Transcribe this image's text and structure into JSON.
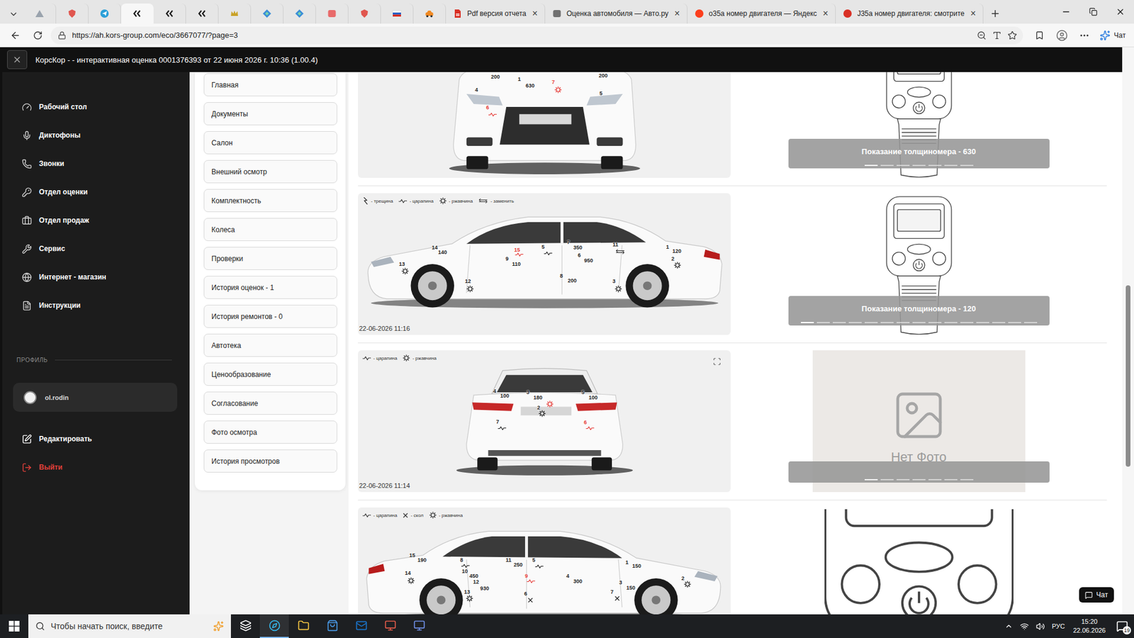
{
  "browser": {
    "pinned_tabs": [
      {
        "color": "#9aa3ad",
        "selected": false
      },
      {
        "color": "#e0564f",
        "selected": false
      },
      {
        "color": "#2a9fd8",
        "selected": false
      },
      {
        "color": "#1b1b1b",
        "selected": true
      },
      {
        "color": "#1b1b1b",
        "selected": false
      },
      {
        "color": "#1b1b1b",
        "selected": false
      },
      {
        "color": "#c9a227",
        "selected": false
      },
      {
        "color": "#3b8ed8",
        "selected": false
      },
      {
        "color": "#3b8ed8",
        "selected": false
      },
      {
        "color": "#e86a6a",
        "selected": false
      },
      {
        "color": "#e0564f",
        "selected": false
      },
      {
        "color": "#d52b1e",
        "selected": false
      },
      {
        "color": "#f08a24",
        "selected": false
      }
    ],
    "tabs": [
      {
        "title": "Pdf версия отчета",
        "color": "#d93025",
        "selected": false
      },
      {
        "title": "Оценка автомобиля — Авто.ру",
        "color": "#707070",
        "selected": false
      },
      {
        "title": "о35а номер двигателя — Яндекс",
        "color": "#fc3f1d",
        "selected": false
      },
      {
        "title": "J35a номер двигателя: смотрите",
        "color": "#d93025",
        "selected": false
      }
    ],
    "close_glyph": "×",
    "url": "https://ah.kors-group.com/eco/3667077/?page=3",
    "copilot": "Чат"
  },
  "app": {
    "title": "КорсКор - - интерактивная оценка 0001376393 от 22 июня 2026 г. 10:36 (1.00.4)"
  },
  "sidebar": {
    "items": [
      {
        "label": "Рабочий стол"
      },
      {
        "label": "Диктофоны"
      },
      {
        "label": "Звонки"
      },
      {
        "label": "Отдел оценки"
      },
      {
        "label": "Отдел продаж"
      },
      {
        "label": "Сервис"
      },
      {
        "label": "Интернет - магазин"
      },
      {
        "label": "Инструкции"
      }
    ],
    "profile_heading": "ПРОФИЛЬ",
    "user": "ol.rodin",
    "actions": [
      {
        "label": "Редактировать",
        "color": "#ffffff"
      },
      {
        "label": "Выйти",
        "color": "#e0403a"
      }
    ]
  },
  "menu": {
    "items": [
      {
        "label": "Главная"
      },
      {
        "label": "Документы"
      },
      {
        "label": "Салон"
      },
      {
        "label": "Внешний осмотр"
      },
      {
        "label": "Комплектность"
      },
      {
        "label": "Колеса"
      },
      {
        "label": "Проверки"
      },
      {
        "label": "История оценок - 1"
      },
      {
        "label": "История ремонтов - 0"
      },
      {
        "label": "Автотека"
      },
      {
        "label": "Ценообразование"
      },
      {
        "label": "Согласование"
      },
      {
        "label": "Фото осмотра"
      },
      {
        "label": "История просмотров"
      }
    ]
  },
  "inspection": {
    "rows": [
      {
        "view": "front",
        "legend": [],
        "expandable": false,
        "marks": [
          {
            "kind": "label",
            "text": "200",
            "color": "#222222"
          },
          {
            "kind": "label",
            "text": "1",
            "color": "#222222"
          },
          {
            "kind": "label",
            "text": "630",
            "color": "#222222"
          },
          {
            "kind": "label",
            "text": "7",
            "color": "#e53935"
          },
          {
            "kind": "rust",
            "color": "#e53935"
          },
          {
            "kind": "label",
            "text": "200",
            "color": "#222222"
          },
          {
            "kind": "label",
            "text": "4",
            "color": "#222222"
          },
          {
            "kind": "label",
            "text": "5",
            "color": "#222222"
          },
          {
            "kind": "label",
            "text": "6",
            "color": "#e53935"
          },
          {
            "kind": "scratch",
            "color": "#e53935"
          }
        ],
        "media": {
          "kind": "gauge",
          "caption": "Показание толщиномера - 630",
          "slides": [
            {
              "selected": true
            },
            {
              "selected": false
            },
            {
              "selected": false
            },
            {
              "selected": false
            },
            {
              "selected": false
            },
            {
              "selected": false
            },
            {
              "selected": false
            }
          ]
        }
      },
      {
        "view": "side-left",
        "date": "22-06-2026 11:16",
        "expandable": false,
        "legend": [
          {
            "kind": "crack",
            "label": "- трещина"
          },
          {
            "kind": "scratch",
            "label": "- царапина"
          },
          {
            "kind": "rust",
            "label": "- ржавчина"
          },
          {
            "kind": "replace",
            "label": "- заменить"
          }
        ],
        "marks": [
          {
            "kind": "label",
            "text": "14",
            "color": "#222222"
          },
          {
            "kind": "label",
            "text": "140",
            "color": "#222222"
          },
          {
            "kind": "label",
            "text": "13",
            "color": "#222222"
          },
          {
            "kind": "rust",
            "color": "#222222"
          },
          {
            "kind": "label",
            "text": "15",
            "color": "#e53935"
          },
          {
            "kind": "scratch",
            "color": "#e53935"
          },
          {
            "kind": "label",
            "text": "9",
            "color": "#222222"
          },
          {
            "kind": "label",
            "text": "110",
            "color": "#222222"
          },
          {
            "kind": "label",
            "text": "5",
            "color": "#222222"
          },
          {
            "kind": "scratch",
            "color": "#222222"
          },
          {
            "kind": "label",
            "text": "7",
            "color": "#222222"
          },
          {
            "kind": "label",
            "text": "350",
            "color": "#222222"
          },
          {
            "kind": "label",
            "text": "6",
            "color": "#222222"
          },
          {
            "kind": "label",
            "text": "950",
            "color": "#222222"
          },
          {
            "kind": "label",
            "text": "11",
            "color": "#222222"
          },
          {
            "kind": "replace",
            "color": "#222222"
          },
          {
            "kind": "label",
            "text": "1",
            "color": "#222222"
          },
          {
            "kind": "label",
            "text": "120",
            "color": "#222222"
          },
          {
            "kind": "label",
            "text": "2",
            "color": "#222222"
          },
          {
            "kind": "rust",
            "color": "#222222"
          },
          {
            "kind": "label",
            "text": "8",
            "color": "#222222"
          },
          {
            "kind": "label",
            "text": "200",
            "color": "#222222"
          },
          {
            "kind": "label",
            "text": "12",
            "color": "#222222"
          },
          {
            "kind": "rust",
            "color": "#222222"
          },
          {
            "kind": "label",
            "text": "3",
            "color": "#222222"
          },
          {
            "kind": "rust",
            "color": "#222222"
          }
        ],
        "media": {
          "kind": "gauge",
          "caption": "Показание толщиномера - 120",
          "slides": [
            {
              "selected": true
            },
            {
              "selected": false
            },
            {
              "selected": false
            },
            {
              "selected": false
            },
            {
              "selected": false
            },
            {
              "selected": false
            },
            {
              "selected": false
            },
            {
              "selected": false
            },
            {
              "selected": false
            },
            {
              "selected": false
            },
            {
              "selected": false
            },
            {
              "selected": false
            },
            {
              "selected": false
            },
            {
              "selected": false
            },
            {
              "selected": false
            }
          ]
        }
      },
      {
        "view": "rear",
        "date": "22-06-2026 11:14",
        "expandable": true,
        "legend": [
          {
            "kind": "scratch",
            "label": "- царапина"
          },
          {
            "kind": "rust",
            "label": "- ржавчина"
          }
        ],
        "marks": [
          {
            "kind": "label",
            "text": "4",
            "color": "#222222"
          },
          {
            "kind": "label",
            "text": "100",
            "color": "#222222"
          },
          {
            "kind": "label",
            "text": "3",
            "color": "#222222"
          },
          {
            "kind": "label",
            "text": "180",
            "color": "#222222"
          },
          {
            "kind": "rust",
            "color": "#e53935"
          },
          {
            "kind": "label",
            "text": "2",
            "color": "#222222"
          },
          {
            "kind": "rust",
            "color": "#222222"
          },
          {
            "kind": "label",
            "text": "5",
            "color": "#222222"
          },
          {
            "kind": "label",
            "text": "100",
            "color": "#222222"
          },
          {
            "kind": "label",
            "text": "7",
            "color": "#222222"
          },
          {
            "kind": "scratch",
            "color": "#222222"
          },
          {
            "kind": "label",
            "text": "6",
            "color": "#e53935"
          },
          {
            "kind": "scratch",
            "color": "#e53935"
          }
        ],
        "media": {
          "kind": "empty",
          "placeholder": "Нет Фото",
          "slides": [
            {
              "selected": true
            },
            {
              "selected": false
            },
            {
              "selected": false
            },
            {
              "selected": false
            },
            {
              "selected": false
            },
            {
              "selected": false
            },
            {
              "selected": false
            }
          ]
        }
      },
      {
        "view": "side-right",
        "expandable": false,
        "legend": [
          {
            "kind": "scratch",
            "label": "- царапина"
          },
          {
            "kind": "chip",
            "label": "- скол"
          },
          {
            "kind": "rust",
            "label": "- ржавчина"
          }
        ],
        "marks": [
          {
            "kind": "label",
            "text": "15",
            "color": "#222222"
          },
          {
            "kind": "label",
            "text": "190",
            "color": "#222222"
          },
          {
            "kind": "label",
            "text": "14",
            "color": "#222222"
          },
          {
            "kind": "rust",
            "color": "#222222"
          },
          {
            "kind": "label",
            "text": "8",
            "color": "#222222"
          },
          {
            "kind": "scratch",
            "color": "#222222"
          },
          {
            "kind": "label",
            "text": "10",
            "color": "#222222"
          },
          {
            "kind": "label",
            "text": "450",
            "color": "#222222"
          },
          {
            "kind": "label",
            "text": "12",
            "color": "#222222"
          },
          {
            "kind": "label",
            "text": "930",
            "color": "#222222"
          },
          {
            "kind": "label",
            "text": "11",
            "color": "#222222"
          },
          {
            "kind": "label",
            "text": "250",
            "color": "#222222"
          },
          {
            "kind": "label",
            "text": "5",
            "color": "#222222"
          },
          {
            "kind": "scratch",
            "color": "#222222"
          },
          {
            "kind": "label",
            "text": "9",
            "color": "#e53935"
          },
          {
            "kind": "scratch",
            "color": "#e53935"
          },
          {
            "kind": "label",
            "text": "13",
            "color": "#222222"
          },
          {
            "kind": "rust",
            "color": "#222222"
          },
          {
            "kind": "label",
            "text": "6",
            "color": "#222222"
          },
          {
            "kind": "chip",
            "color": "#222222"
          },
          {
            "kind": "label",
            "text": "4",
            "color": "#222222"
          },
          {
            "kind": "label",
            "text": "300",
            "color": "#222222"
          },
          {
            "kind": "label",
            "text": "1",
            "color": "#222222"
          },
          {
            "kind": "label",
            "text": "150",
            "color": "#222222"
          },
          {
            "kind": "label",
            "text": "3",
            "color": "#222222"
          },
          {
            "kind": "label",
            "text": "150",
            "color": "#222222"
          },
          {
            "kind": "label",
            "text": "7",
            "color": "#222222"
          },
          {
            "kind": "chip",
            "color": "#222222"
          },
          {
            "kind": "label",
            "text": "2",
            "color": "#222222"
          },
          {
            "kind": "rust",
            "color": "#222222"
          }
        ],
        "media": {
          "kind": "gauge-zoom"
        }
      }
    ]
  },
  "chat_button": "Чат",
  "page_scrollbar": {
    "level": 0.32,
    "offset": 0.42
  },
  "taskbar": {
    "search_placeholder": "Чтобы начать поиск, введите",
    "apps": [
      {
        "color": "#ffffff",
        "selected": false
      },
      {
        "color": "#35b4e8",
        "selected": true
      },
      {
        "color": "#f4c542",
        "selected": false
      },
      {
        "color": "#4a9be8",
        "selected": false
      },
      {
        "color": "#1a73c8",
        "selected": false
      },
      {
        "color": "#e25b4a",
        "selected": false
      },
      {
        "color": "#6f8fe6",
        "selected": false
      }
    ],
    "language": "РУС",
    "time": "15:20",
    "date": "22.06.2026",
    "notifications": "19"
  }
}
